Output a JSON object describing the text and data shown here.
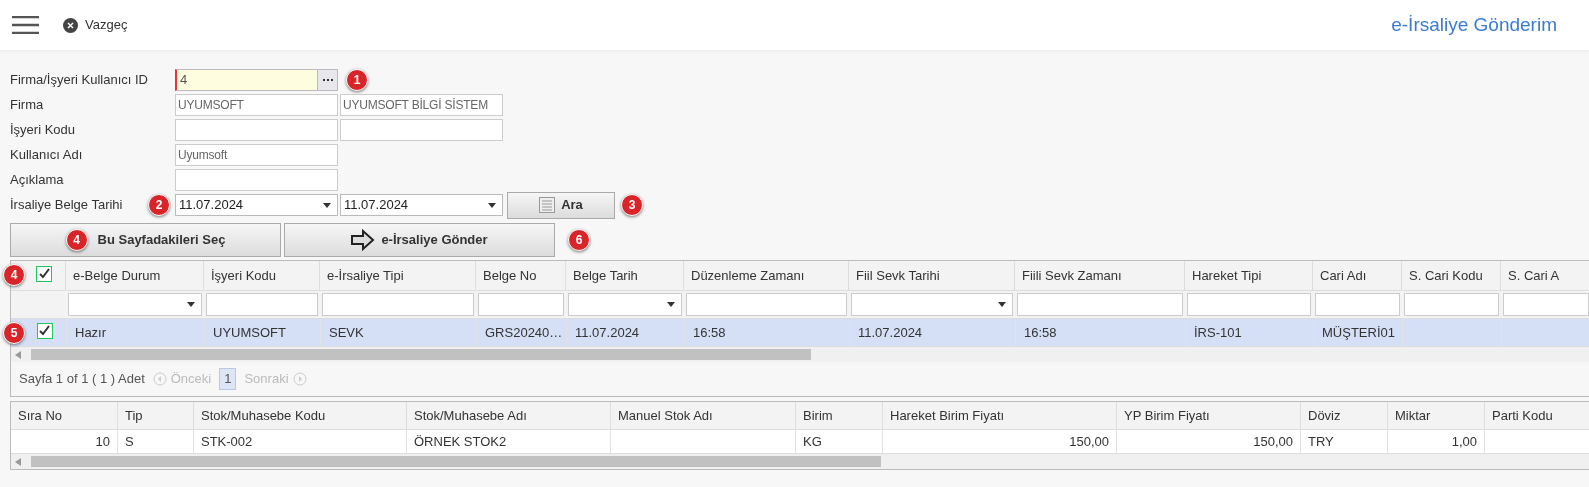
{
  "header": {
    "cancel_label": "Vazgeç",
    "title": "e-İrsaliye Gönderim"
  },
  "form": {
    "rows": [
      {
        "label": "Firma/İşyeri Kullanıcı ID",
        "badge": "1",
        "fields": [
          {
            "kind": "lookup",
            "value": "4"
          }
        ]
      },
      {
        "label": "Firma",
        "fields": [
          {
            "kind": "text",
            "value": "UYUMSOFT"
          },
          {
            "kind": "text",
            "value": "UYUMSOFT BİLGİ SİSTEM"
          }
        ]
      },
      {
        "label": "İşyeri Kodu",
        "fields": [
          {
            "kind": "text"
          },
          {
            "kind": "text"
          }
        ]
      },
      {
        "label": "Kullanıcı Adı",
        "fields": [
          {
            "kind": "text",
            "value": "Uyumsoft"
          }
        ]
      },
      {
        "label": "Açıklama",
        "fields": [
          {
            "kind": "text"
          }
        ]
      },
      {
        "label": "İrsaliye Belge Tarihi",
        "badge": "2",
        "fields": [
          {
            "kind": "date",
            "value": "11.07.2024"
          },
          {
            "kind": "date",
            "value": "11.07.2024"
          }
        ],
        "search": {
          "label": "Ara",
          "badge": "3"
        }
      }
    ]
  },
  "actions": [
    {
      "kind": "select",
      "label": "Bu Sayfadakileri Seç",
      "badge": "4"
    },
    {
      "kind": "send",
      "label": "e-İrsaliye Gönder",
      "badge": "6"
    }
  ],
  "grid": {
    "select_all": {
      "checked": true,
      "badge": "4"
    },
    "columns": [
      {
        "label": "e-Belge Durum",
        "filter_dropdown": true
      },
      {
        "label": "İşyeri Kodu",
        "filter_dropdown": false
      },
      {
        "label": "e-İrsaliye Tipi",
        "filter_dropdown": false
      },
      {
        "label": "Belge No",
        "filter_dropdown": false
      },
      {
        "label": "Belge Tarih",
        "filter_dropdown": true
      },
      {
        "label": "Düzenleme Zamanı",
        "filter_dropdown": false
      },
      {
        "label": "Fiil Sevk Tarihi",
        "filter_dropdown": true
      },
      {
        "label": "Fiili Sevk Zamanı",
        "filter_dropdown": false
      },
      {
        "label": "Hareket Tipi",
        "filter_dropdown": false
      },
      {
        "label": "Cari Adı",
        "filter_dropdown": false
      },
      {
        "label": "S. Cari Kodu",
        "filter_dropdown": false
      },
      {
        "label": "S. Cari A",
        "filter_dropdown": false
      }
    ],
    "rows": [
      {
        "checked": true,
        "selected": true,
        "badge": "5",
        "cells": [
          "Hazır",
          "UYUMSOFT",
          "SEVK",
          "GRS20240…",
          "11.07.2024",
          "16:58",
          "11.07.2024",
          "16:58",
          "İRS-101",
          "MÜŞTERİ01",
          "",
          ""
        ]
      }
    ]
  },
  "pager": {
    "summary": "Sayfa 1 of 1 ( 1 ) Adet",
    "prev": "Önceki",
    "page": "1",
    "next": "Sonraki"
  },
  "lines": {
    "columns": [
      {
        "label": "Sıra No",
        "numeric": true
      },
      {
        "label": "Tip",
        "numeric": false
      },
      {
        "label": "Stok/Muhasebe Kodu",
        "numeric": false
      },
      {
        "label": "Stok/Muhasebe Adı",
        "numeric": false
      },
      {
        "label": "Manuel Stok Adı"
      },
      {
        "label": "Birim",
        "numeric": false
      },
      {
        "label": "Hareket Birim Fiyatı",
        "numeric": true
      },
      {
        "label": "YP Birim Fiyatı",
        "numeric": true
      },
      {
        "label": "Döviz",
        "numeric": false
      },
      {
        "label": "Miktar",
        "numeric": true
      },
      {
        "label": "Parti Kodu"
      }
    ],
    "rows": [
      {
        "cells": [
          "10",
          "S",
          "STK-002",
          "ÖRNEK STOK2",
          "",
          "KG",
          "150,00",
          "150,00",
          "TRY",
          "1,00",
          ""
        ]
      }
    ]
  }
}
